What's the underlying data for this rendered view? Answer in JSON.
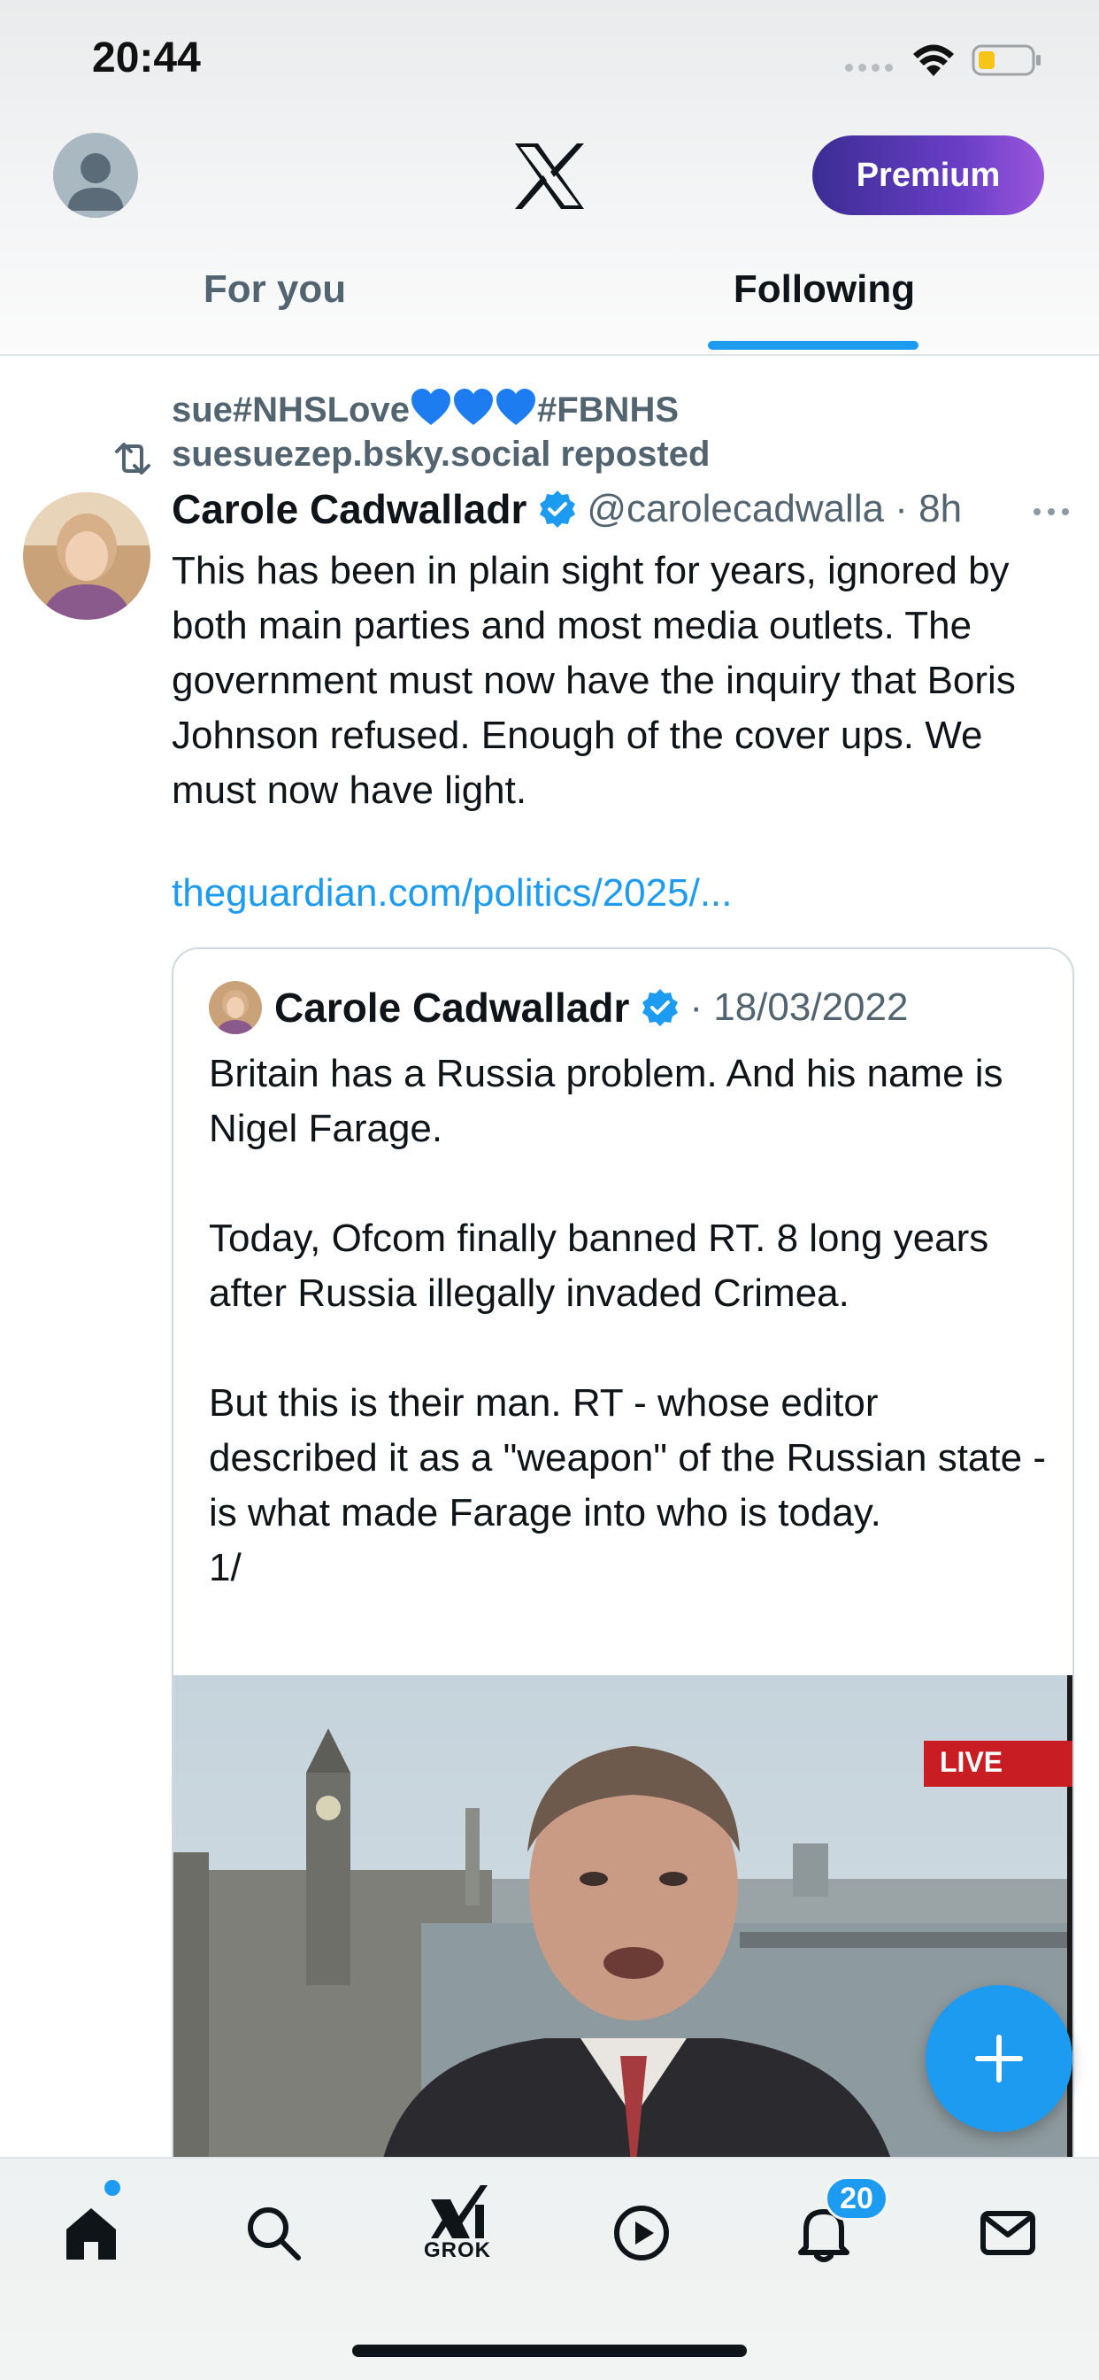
{
  "status_bar": {
    "time": "20:44"
  },
  "header": {
    "premium_label": "Premium",
    "tabs": [
      {
        "label": "For you",
        "active": false
      },
      {
        "label": "Following",
        "active": true
      }
    ]
  },
  "tweet": {
    "repost_user_prefix": "sue#NHSLove",
    "repost_user_suffix": "#FBNHS",
    "repost_line2": "suesuezep.bsky.social reposted",
    "author_name": "Carole Cadwalladr",
    "handle_time": "@carolecadwalla · 8h",
    "text": "This has been in plain sight for years, ignored by both main parties and most media outlets. The government must now have the inquiry that Boris Johnson refused. Enough of the cover ups. We must now have light.",
    "link": "theguardian.com/politics/2025/..."
  },
  "quote": {
    "author_name": "Carole Cadwalladr",
    "date": " · 18/03/2022",
    "text": "Britain has a Russia problem. And his name is Nigel Farage.\n\nToday, Ofcom finally banned RT. 8 long years after Russia illegally invaded Crimea.\n\nBut this is their man. RT - whose editor described it as a \"weapon\" of the Russian state - is what made Farage into who is today.\n1/",
    "media_badge": "LIVE"
  },
  "bottom_nav": {
    "grok_label": "GROK",
    "notification_count": "20"
  },
  "colors": {
    "accent": "#1d9bf0",
    "premium_gradient_start": "#3b2d93",
    "premium_gradient_end": "#9a56dc",
    "secondary_text": "#536471"
  },
  "icons": [
    "wifi-icon",
    "battery-icon",
    "x-logo-icon",
    "repost-icon",
    "verified-icon",
    "more-icon",
    "compose-icon",
    "home-icon",
    "search-icon",
    "grok-icon",
    "video-icon",
    "notifications-icon",
    "messages-icon"
  ]
}
